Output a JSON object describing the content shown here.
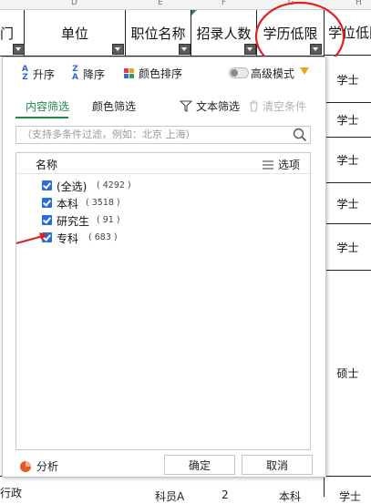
{
  "sheet": {
    "column_letters": [
      "D",
      "E",
      "F",
      "G",
      "H"
    ],
    "headers": {
      "partial_left": "门",
      "unit": "单位",
      "position_name": "职位名称",
      "recruit_count": "招录人数",
      "min_education": "学历低限",
      "min_degree": "学位低限"
    },
    "right_cells": [
      "学士",
      "学士",
      "学士",
      "学士",
      "学士",
      "硕士"
    ],
    "bottom_cells": {
      "left": "行政",
      "position": "科员A",
      "count": "2",
      "edu": "本科",
      "degree": "学士"
    }
  },
  "filter_panel": {
    "toolbar": {
      "sort_asc": "升序",
      "sort_desc": "降序",
      "color_sort": "颜色排序",
      "advanced_mode": "高级模式",
      "advanced_mode_on": false
    },
    "tabs": {
      "content_filter": "内容筛选",
      "color_filter": "颜色筛选",
      "text_filter": "文本筛选",
      "clear_conditions": "清空条件"
    },
    "search_placeholder": "（支持多条件过滤，例如：北京 上海）",
    "list": {
      "header_name": "名称",
      "header_options": "选项",
      "items": [
        {
          "label": "(全选)",
          "count": "( 4292 )",
          "checked": true
        },
        {
          "label": "本科",
          "count": "( 3518 )",
          "checked": true
        },
        {
          "label": "研究生",
          "count": "( 91 )",
          "checked": true
        },
        {
          "label": "专科",
          "count": "( 683 )",
          "checked": true
        }
      ]
    },
    "footer": {
      "analysis": "分析",
      "ok": "确定",
      "cancel": "取消"
    }
  },
  "colors": {
    "accent_green": "#1e8a4c",
    "checkbox_blue": "#2b6cd6",
    "annotation_red": "#e02020"
  }
}
